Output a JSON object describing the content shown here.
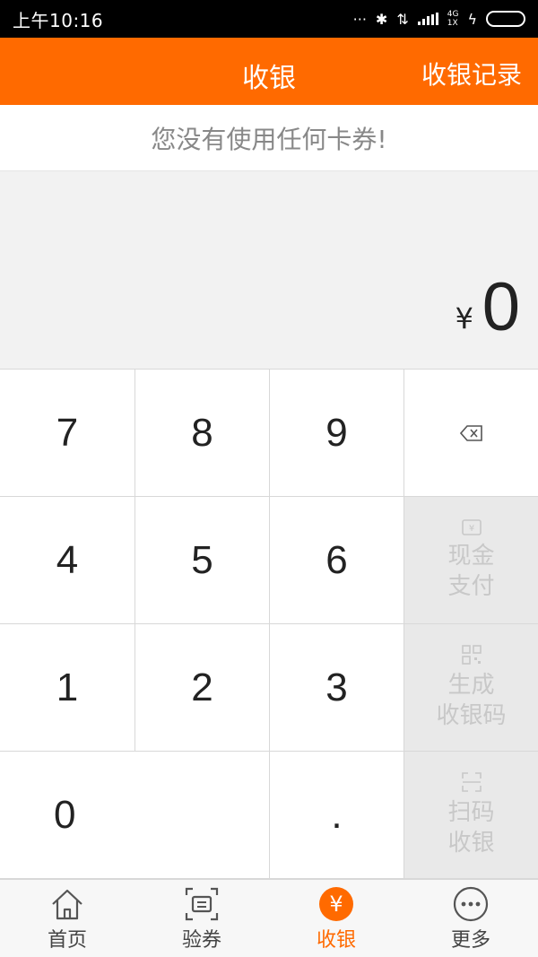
{
  "status_bar": {
    "time": "上午10:16",
    "network_top": "4G",
    "network_bottom": "1X"
  },
  "header": {
    "title": "收银",
    "records_label": "收银记录"
  },
  "coupon_notice": "您没有使用任何卡券!",
  "amount": {
    "currency": "¥",
    "value": "0"
  },
  "keypad": {
    "keys": [
      "7",
      "8",
      "9",
      "4",
      "5",
      "6",
      "1",
      "2",
      "3",
      "0",
      "."
    ],
    "delete_icon": "backspace-icon",
    "actions": [
      {
        "icon": "cash-icon",
        "line1": "现金",
        "line2": "支付"
      },
      {
        "icon": "qr-code-icon",
        "line1": "生成",
        "line2": "收银码"
      },
      {
        "icon": "scan-icon",
        "line1": "扫码",
        "line2": "收银"
      }
    ]
  },
  "bottom_nav": {
    "items": [
      {
        "label": "首页",
        "icon": "home-icon"
      },
      {
        "label": "验券",
        "icon": "ticket-scan-icon"
      },
      {
        "label": "收银",
        "icon": "yuan-icon"
      },
      {
        "label": "更多",
        "icon": "more-icon"
      }
    ],
    "active_index": 2
  },
  "colors": {
    "brand": "#ff6a00",
    "status_bar": "#000000",
    "battery": "#44d144",
    "side_key_bg": "#e9e9e9"
  }
}
